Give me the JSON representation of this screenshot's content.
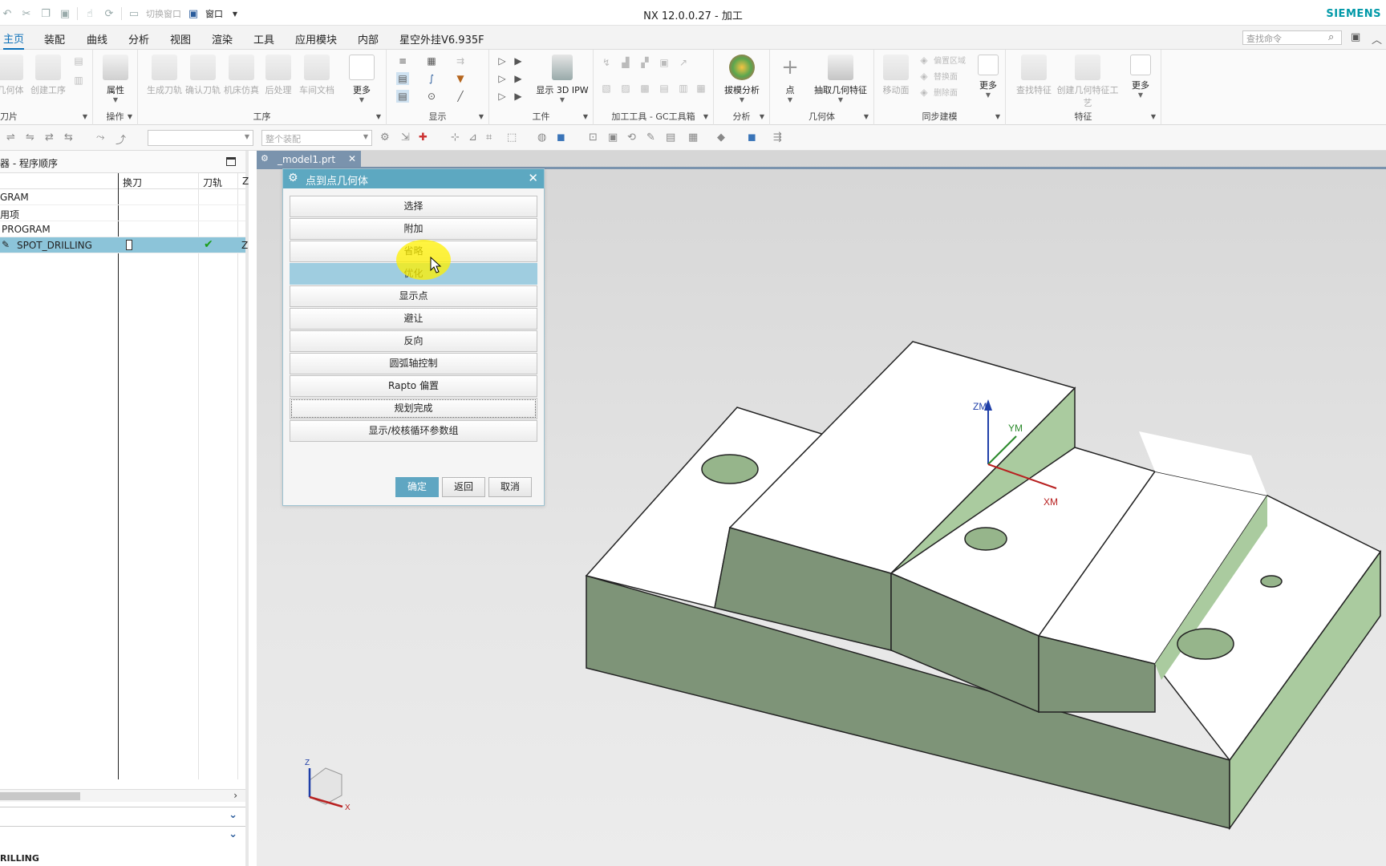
{
  "titlebar": {
    "qat_switch_window": "切换窗口",
    "qat_window": "窗口",
    "title": "NX 12.0.0.27 - 加工",
    "brand": "SIEMENS"
  },
  "menu": {
    "tabs": [
      "主页",
      "装配",
      "曲线",
      "分析",
      "视图",
      "渲染",
      "工具",
      "应用模块",
      "内部",
      "星空外挂V6.935F"
    ],
    "search_placeholder": "查找命令"
  },
  "ribbon": {
    "groups": [
      "刀片",
      "操作",
      "工序",
      "显示",
      "工件",
      "加工工具 - GC工具箱",
      "分析",
      "几何体",
      "同步建模",
      "特征"
    ],
    "buttons": {
      "geom": "几何体",
      "create_op": "创建工序",
      "attr": "属性",
      "gen_path": "生成刀轨",
      "confirm_path": "确认刀轨",
      "sim": "机床仿真",
      "post": "后处理",
      "shopdoc": "车间文档",
      "more1": "更多",
      "show_ipw": "显示 3D IPW",
      "draft": "拔模分析",
      "point": "点",
      "extract": "抽取几何特征",
      "move_face": "移动面",
      "offset_region": "偏置区域",
      "replace_face": "替换面",
      "delete_face": "删除面",
      "more2": "更多",
      "find_feat": "查找特征",
      "create_feat_proc": "创建几何特征工艺",
      "more3": "更多"
    }
  },
  "toolbar2": {
    "assembly_combo": "整个装配"
  },
  "navigator": {
    "title": "器 - 程序顺序",
    "col_toolchange": "换刀",
    "col_path": "刀轨",
    "col_z": "Z",
    "rows": [
      "GRAM",
      "用项",
      "PROGRAM",
      "SPOT_DRILLING"
    ],
    "selected_row_z": "Z",
    "bottom_label": "RILLING"
  },
  "file_tab": {
    "name": "_model1.prt"
  },
  "viewport": {
    "axis_zm": "ZM",
    "axis_ym": "YM",
    "axis_xm": "XM",
    "triad_z": "Z",
    "triad_x": "X",
    "colors": {
      "side_face": "#7e9478",
      "wall_face": "#aacb9f",
      "top_face": "#ffffff",
      "hole": "#96b58b"
    }
  },
  "dialog": {
    "title": "点到点几何体",
    "options": [
      "选择",
      "附加",
      "省略",
      "优化",
      "显示点",
      "避让",
      "反向",
      "圆弧轴控制",
      "Rapto 偏置",
      "规划完成",
      "显示/校核循环参数组"
    ],
    "active_index": 3,
    "ok": "确定",
    "back": "返回",
    "cancel": "取消"
  }
}
